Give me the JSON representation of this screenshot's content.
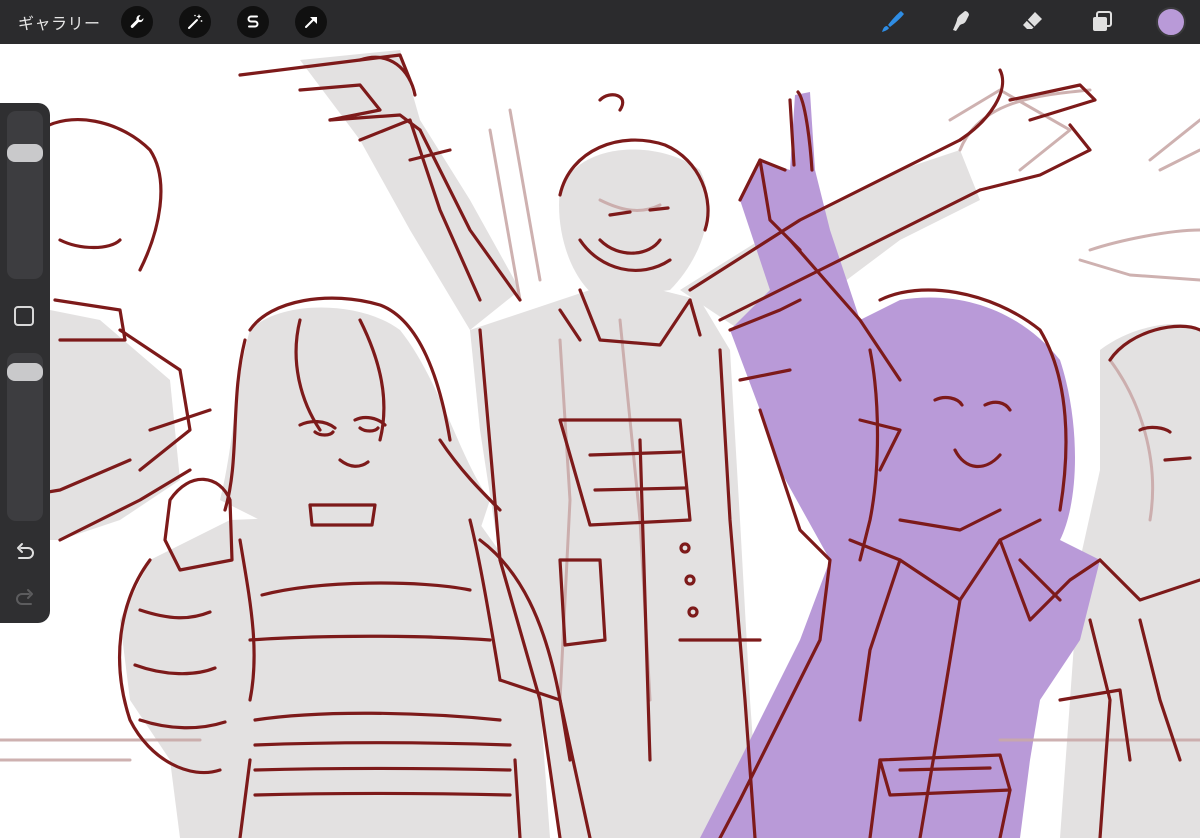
{
  "toolbar": {
    "gallery_label": "ギャラリー",
    "left_tools": [
      {
        "name": "adjustments",
        "icon": "wrench-icon"
      },
      {
        "name": "adjust",
        "icon": "magic-wand-icon"
      },
      {
        "name": "selection",
        "icon": "selection-s-icon"
      },
      {
        "name": "transform",
        "icon": "arrow-cursor-icon"
      }
    ],
    "right_tools": [
      {
        "name": "brush",
        "icon": "brush-icon",
        "active": true
      },
      {
        "name": "smudge",
        "icon": "smudge-icon",
        "active": false
      },
      {
        "name": "eraser",
        "icon": "eraser-icon",
        "active": false
      },
      {
        "name": "layers",
        "icon": "layers-icon",
        "active": false
      }
    ],
    "current_color": "#b99ad8"
  },
  "sidebar": {
    "brush_size_level": 0.78,
    "opacity_level": 0.93,
    "modify_icon": "square-icon",
    "undo_icon": "undo-icon",
    "redo_icon": "redo-icon"
  },
  "colors": {
    "toolbar_bg": "#2b2b2d",
    "active_tool": "#2f8de4",
    "sketch_red": "#7d1a1a",
    "fill_gray": "#e3e1e1",
    "fill_purple": "#b99ad8",
    "faint_line": "#c9a9a8"
  }
}
